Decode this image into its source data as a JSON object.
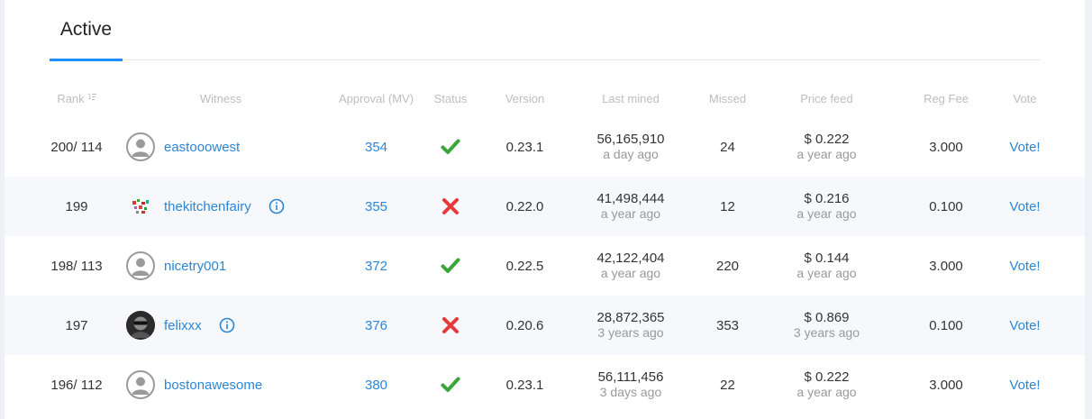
{
  "tabs": {
    "active_label": "Active"
  },
  "table": {
    "headers": {
      "rank": "Rank",
      "witness": "Witness",
      "approval": "Approval (MV)",
      "status": "Status",
      "version": "Version",
      "last_mined": "Last mined",
      "missed": "Missed",
      "price_feed": "Price feed",
      "reg_fee": "Reg Fee",
      "vote": "Vote"
    },
    "rows": [
      {
        "rank": "200/ 114",
        "witness": "eastooowest",
        "avatar": "default-user-icon",
        "info": false,
        "approval": "354",
        "status": "check",
        "version": "0.23.1",
        "last_mined": "56,165,910",
        "last_mined_ago": "a day ago",
        "missed": "24",
        "price": "$ 0.222",
        "price_ago": "a year ago",
        "reg_fee": "3.000",
        "vote": "Vote!"
      },
      {
        "rank": "199",
        "witness": "thekitchenfairy",
        "avatar": "kitchen-avatar-icon",
        "info": true,
        "approval": "355",
        "status": "cross",
        "version": "0.22.0",
        "last_mined": "41,498,444",
        "last_mined_ago": "a year ago",
        "missed": "12",
        "price": "$ 0.216",
        "price_ago": "a year ago",
        "reg_fee": "0.100",
        "vote": "Vote!"
      },
      {
        "rank": "198/ 113",
        "witness": "nicetry001",
        "avatar": "default-user-icon",
        "info": false,
        "approval": "372",
        "status": "check",
        "version": "0.22.5",
        "last_mined": "42,122,404",
        "last_mined_ago": "a year ago",
        "missed": "220",
        "price": "$ 0.144",
        "price_ago": "a year ago",
        "reg_fee": "3.000",
        "vote": "Vote!"
      },
      {
        "rank": "197",
        "witness": "felixxx",
        "avatar": "sunglasses-avatar-icon",
        "info": true,
        "approval": "376",
        "status": "cross",
        "version": "0.20.6",
        "last_mined": "28,872,365",
        "last_mined_ago": "3 years ago",
        "missed": "353",
        "price": "$ 0.869",
        "price_ago": "3 years ago",
        "reg_fee": "0.100",
        "vote": "Vote!"
      },
      {
        "rank": "196/ 112",
        "witness": "bostonawesome",
        "avatar": "default-user-icon",
        "info": false,
        "approval": "380",
        "status": "check",
        "version": "0.23.1",
        "last_mined": "56,111,456",
        "last_mined_ago": "3 days ago",
        "missed": "22",
        "price": "$ 0.222",
        "price_ago": "a year ago",
        "reg_fee": "3.000",
        "vote": "Vote!"
      }
    ]
  },
  "colors": {
    "accent": "#1890ff",
    "link": "#2b86d6",
    "ok": "#3aa63a",
    "error": "#e5393a"
  }
}
